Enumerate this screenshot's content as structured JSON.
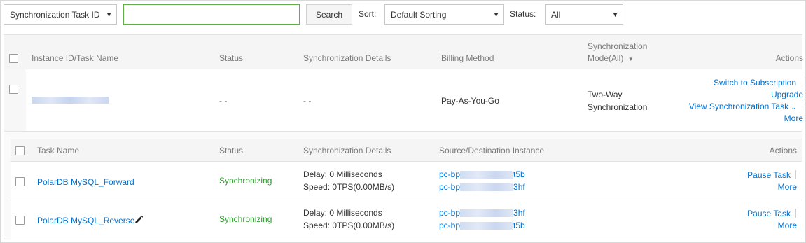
{
  "toolbar": {
    "search_type": "Synchronization Task ID",
    "search_value": "",
    "search_button": "Search",
    "sort_label": "Sort:",
    "sort_value": "Default Sorting",
    "status_label": "Status:",
    "status_value": "All"
  },
  "main_table": {
    "headers": {
      "instance": "Instance ID/Task Name",
      "status": "Status",
      "details": "Synchronization Details",
      "billing": "Billing Method",
      "mode_line1": "Synchronization",
      "mode_line2": "Mode(All)",
      "actions": "Actions"
    },
    "row": {
      "status": "- -",
      "details": "- -",
      "billing": "Pay-As-You-Go",
      "mode_line1": "Two-Way",
      "mode_line2": "Synchronization",
      "action_switch": "Switch to Subscription",
      "action_upgrade": "Upgrade",
      "action_view": "View Synchronization Task",
      "action_more": "More"
    }
  },
  "sub_table": {
    "headers": {
      "task": "Task Name",
      "status": "Status",
      "details": "Synchronization Details",
      "instance": "Source/Destination Instance",
      "actions": "Actions"
    },
    "rows": [
      {
        "name": "PolarDB MySQL_Forward",
        "status": "Synchronizing",
        "delay": "Delay: 0 Milliseconds",
        "speed": "Speed: 0TPS(0.00MB/s)",
        "src_prefix": "pc-bp",
        "src_suffix": "t5b",
        "dst_prefix": "pc-bp",
        "dst_suffix": "3hf",
        "pause": "Pause Task",
        "more": "More"
      },
      {
        "name": "PolarDB MySQL_Reverse",
        "status": "Synchronizing",
        "delay": "Delay: 0 Milliseconds",
        "speed": "Speed: 0TPS(0.00MB/s)",
        "src_prefix": "pc-bp",
        "src_suffix": "3hf",
        "dst_prefix": "pc-bp",
        "dst_suffix": "t5b",
        "pause": "Pause Task",
        "more": "More"
      }
    ]
  },
  "colors": {
    "link": "#0070cc",
    "synchronizing": "#2d9a2d",
    "input_border": "#5fb044"
  }
}
